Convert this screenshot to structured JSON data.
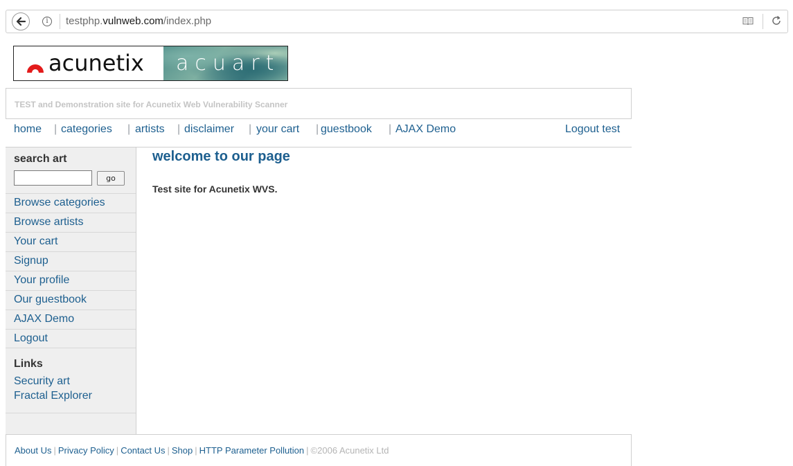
{
  "browser": {
    "url_prefix": "testphp.",
    "url_domain": "vulnweb.com",
    "url_path": "/index.php"
  },
  "logo": {
    "left_text": "acunetix",
    "right_text": "acuart"
  },
  "tagline": "TEST and Demonstration site for Acunetix Web Vulnerability Scanner",
  "top_nav": {
    "items": [
      "home",
      "categories",
      "artists",
      "disclaimer",
      "your cart",
      "guestbook",
      "AJAX Demo"
    ],
    "logout": "Logout test"
  },
  "sidebar": {
    "search_title": "search art",
    "search_input_value": "",
    "search_button": "go",
    "items": [
      "Browse categories",
      "Browse artists",
      "Your cart",
      "Signup",
      "Your profile",
      "Our guestbook",
      "AJAX Demo",
      "Logout"
    ],
    "links_title": "Links",
    "links": [
      "Security art",
      "Fractal Explorer"
    ]
  },
  "main": {
    "title": "welcome to our page",
    "text": "Test site for Acunetix WVS."
  },
  "footer": {
    "links": [
      "About Us",
      "Privacy Policy",
      "Contact Us",
      "Shop",
      "HTTP Parameter Pollution"
    ],
    "copyright": "©2006 Acunetix Ltd"
  }
}
